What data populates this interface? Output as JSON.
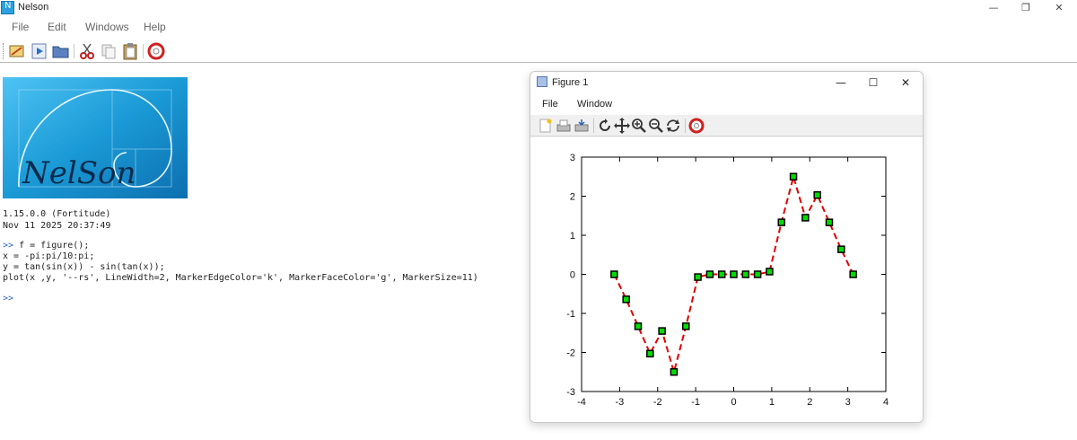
{
  "app": {
    "title": "Nelson",
    "icon": "nelson-app-icon"
  },
  "window_controls": {
    "minimize": "—",
    "restore": "❐",
    "close": "✕"
  },
  "menu": [
    "File",
    "Edit",
    "Windows",
    "Help"
  ],
  "toolbar": [
    {
      "name": "editor-icon"
    },
    {
      "name": "run-icon"
    },
    {
      "name": "open-folder-icon"
    },
    {
      "name": "cut-icon"
    },
    {
      "name": "copy-icon"
    },
    {
      "name": "paste-icon"
    },
    {
      "name": "help-icon"
    }
  ],
  "colors": {
    "prompt": "#2a62c8",
    "logo_bg": "#1a9ad6",
    "series_line": "#e00000",
    "marker_face": "#00dd00",
    "marker_edge": "#000000"
  },
  "console": {
    "logo_text": "NelSon",
    "version": "1.15.0.0 (Fortitude)",
    "build_date": "Nov 11 2025 20:37:49",
    "prompt": ">>",
    "commands": [
      " f = figure();",
      "x = -pi:pi/10:pi;",
      "y = tan(sin(x)) - sin(tan(x));",
      "plot(x ,y, '--rs', LineWidth=2, MarkerEdgeColor='k', MarkerFaceColor='g', MarkerSize=11)"
    ],
    "empty_prompt": ">>"
  },
  "figure": {
    "title": "Figure 1",
    "controls": {
      "minimize": "—",
      "maximize": "☐",
      "close": "✕"
    },
    "menu": [
      "File",
      "Window"
    ],
    "toolbar": [
      {
        "name": "new-figure-icon"
      },
      {
        "name": "print-icon"
      },
      {
        "name": "export-icon"
      },
      {
        "name": "rotate-icon"
      },
      {
        "name": "pan-icon"
      },
      {
        "name": "zoom-in-icon"
      },
      {
        "name": "zoom-out-icon"
      },
      {
        "name": "refresh-icon"
      },
      {
        "name": "help-icon"
      }
    ]
  },
  "chart_data": {
    "type": "line",
    "title": "",
    "xlabel": "",
    "ylabel": "",
    "xlim": [
      -4,
      4
    ],
    "ylim": [
      -3,
      3
    ],
    "xticks": [
      "-4",
      "-3",
      "-2",
      "-1",
      "0",
      "1",
      "2",
      "3",
      "4"
    ],
    "yticks": [
      "-3",
      "-2",
      "-1",
      "0",
      "1",
      "2",
      "3"
    ],
    "grid": false,
    "line_style": "dashed",
    "marker": "square",
    "series": [
      {
        "x": [
          -3.1416,
          -2.8274,
          -2.5133,
          -2.1991,
          -1.885,
          -1.5708,
          -1.2566,
          -0.9425,
          -0.6283,
          -0.3142,
          0,
          0.3142,
          0.6283,
          0.9425,
          1.2566,
          1.5708,
          1.885,
          2.1991,
          2.5133,
          2.8274,
          3.1416
        ],
        "values": [
          0,
          -0.64,
          -1.33,
          -2.03,
          -1.45,
          -2.5,
          -1.33,
          -0.07,
          0,
          0,
          0,
          0,
          0,
          0.07,
          1.33,
          2.5,
          1.45,
          2.03,
          1.33,
          0.64,
          0
        ]
      }
    ]
  }
}
